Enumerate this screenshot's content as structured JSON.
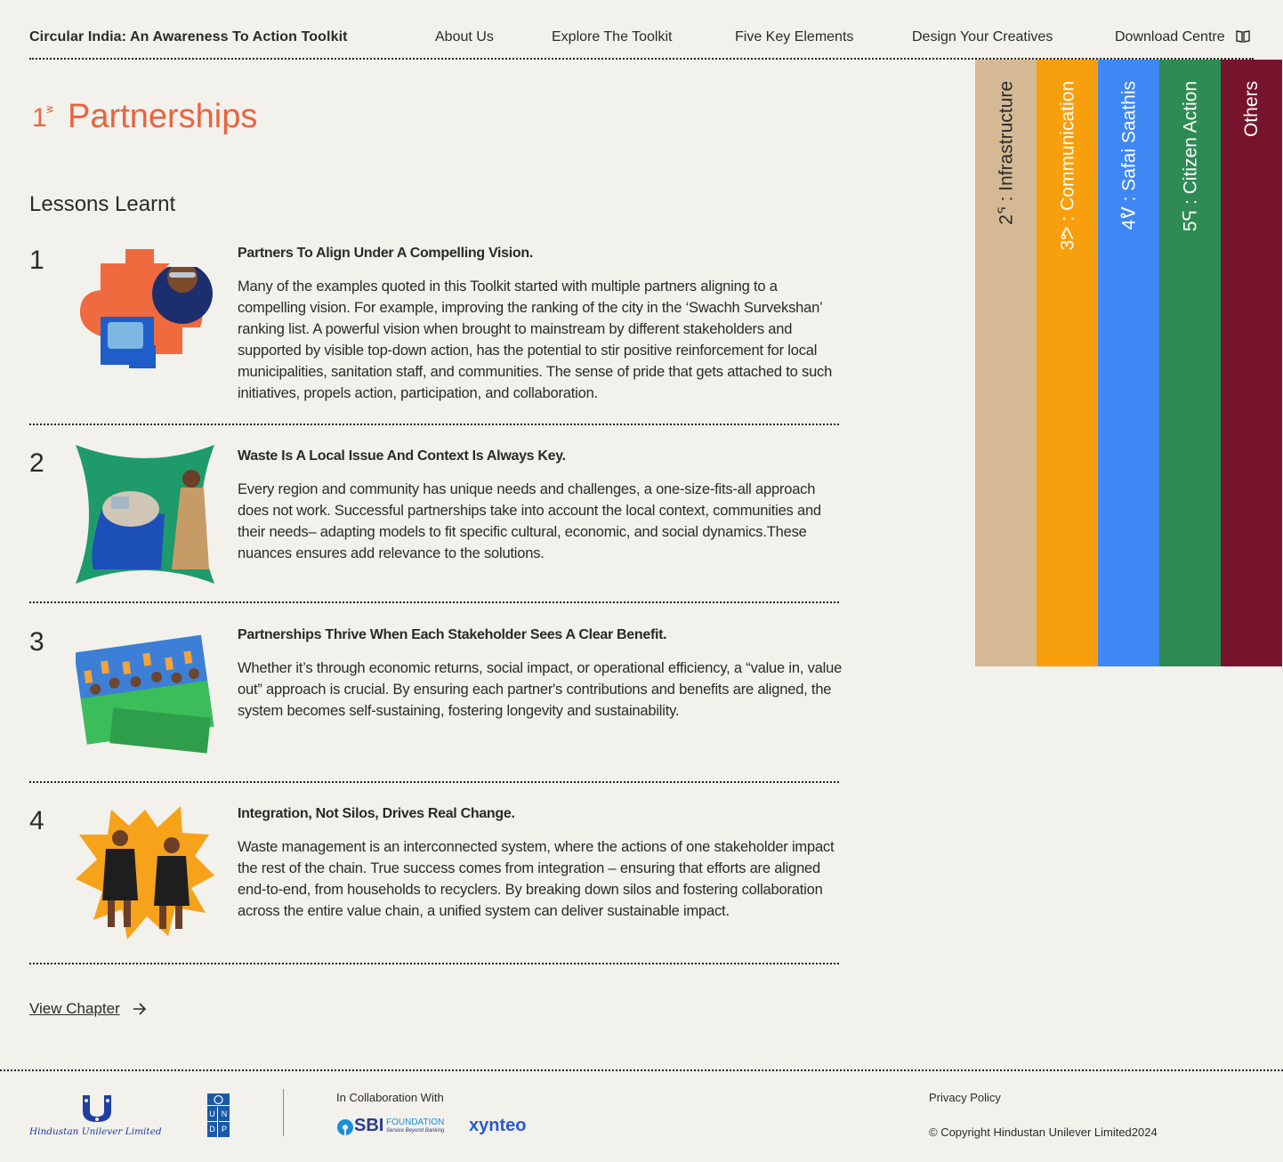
{
  "header": {
    "site_title": "Circular India: An Awareness To Action Toolkit",
    "nav": [
      "About Us",
      "Explore The Toolkit",
      "Five Key Elements",
      "Design Your Creatives",
      "Download Centre"
    ]
  },
  "chapter": {
    "number": "1",
    "sup": "ᕒ",
    "title": "Partnerships",
    "color": "#e8653e"
  },
  "section_title": "Lessons Learnt",
  "lessons": [
    {
      "number": "1",
      "heading": "Partners To Align Under A Compelling Vision.",
      "body": "Many of the examples quoted in this Toolkit started with multiple partners aligning to a compelling vision. For example, improving the ranking of the city in the ‘Swachh Survekshan’ ranking list. A powerful vision when brought to mainstream by different stakeholders and supported by visible top-down action, has the potential to stir positive reinforcement for local municipalities, sanitation staff, and communities. The sense of pride that gets attached to such initiatives, propels action, participation, and collaboration."
    },
    {
      "number": "2",
      "heading": "Waste Is A Local Issue And Context Is Always Key.",
      "body": "Every region and community has unique needs and challenges, a one-size-fits-all approach does not work. Successful partnerships take into account the local  context, communities and their needs– adapting models to fit specific cultural, economic, and social dynamics.These nuances ensures add relevance to the solutions."
    },
    {
      "number": "3",
      "heading": "Partnerships Thrive When Each Stakeholder Sees A Clear Benefit.",
      "body": "Whether it’s through economic returns, social impact, or operational efficiency, a “value in, value out” approach is crucial. By ensuring each partner's contributions and benefits are aligned, the system becomes self-sustaining, fostering longevity and sustainability."
    },
    {
      "number": "4",
      "heading": "Integration, Not Silos, Drives Real Change.",
      "body": "Waste management is an interconnected system, where the actions of one stakeholder impact the rest of the chain. True success comes from integration – ensuring that efforts are aligned end-to-end, from households to recyclers. By breaking down silos and fostering collaboration across the entire value chain, a unified system can deliver sustainable impact."
    }
  ],
  "view_chapter": "View Chapter",
  "tabs": [
    {
      "label": "2ᕐ : Infrastructure",
      "bg": "#d4b994",
      "fg": "#2a2a2a"
    },
    {
      "label": "3ᕗ : Communication",
      "bg": "#f89f0d",
      "fg": "#ffffff"
    },
    {
      "label": "4ᕓ : Safai Saathis",
      "bg": "#3f87f4",
      "fg": "#ffffff"
    },
    {
      "label": "5ᕋ : Citizen Action",
      "bg": "#2e8b53",
      "fg": "#ffffff"
    },
    {
      "label": "Others",
      "bg": "#76142e",
      "fg": "#ffffff"
    }
  ],
  "footer": {
    "hul_text": "Hindustan Unilever Limited",
    "undp_letters": [
      "U",
      "N",
      "D",
      "P"
    ],
    "collab_label": "In Collaboration With",
    "sbi_text": "SBI",
    "sbi_foundation": "FOUNDATION",
    "sbi_tagline": "Service Beyond Banking",
    "xynteo": "xynteo",
    "privacy": "Privacy Policy",
    "copyright": "© Copyright Hindustan Unilever Limited2024"
  }
}
